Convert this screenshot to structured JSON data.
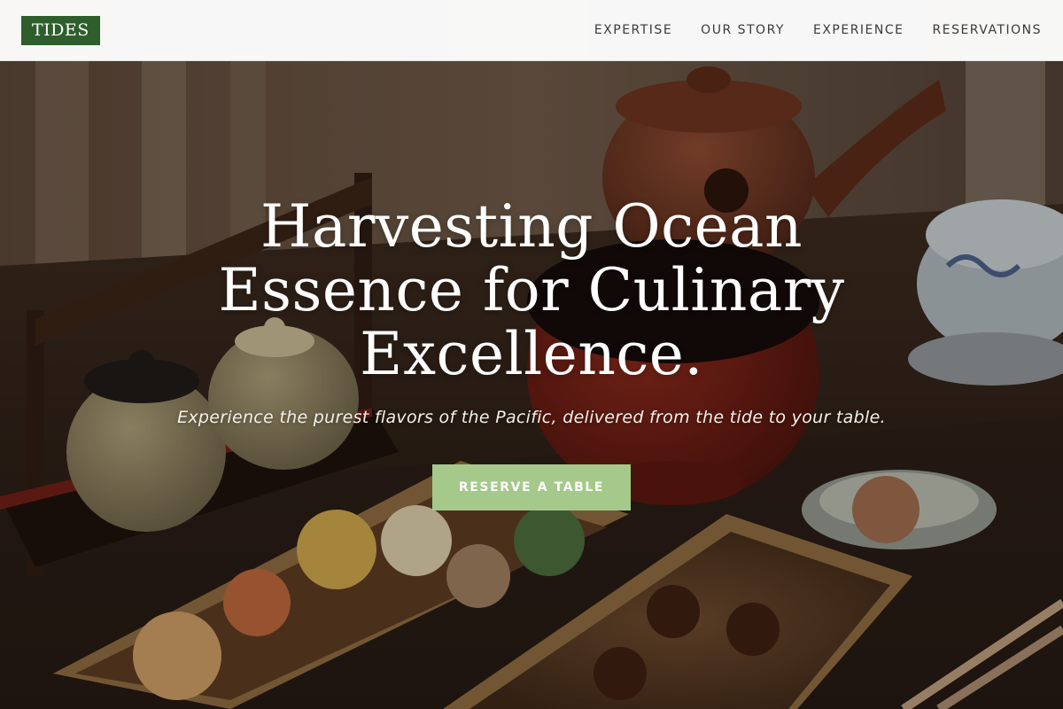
{
  "brand": {
    "logo_text": "TIDES",
    "logo_color": "#2e5e2c"
  },
  "nav": {
    "items": [
      {
        "label": "EXPERTISE"
      },
      {
        "label": "OUR STORY"
      },
      {
        "label": "EXPERIENCE"
      },
      {
        "label": "RESERVATIONS"
      }
    ]
  },
  "hero": {
    "headline": "Harvesting Ocean Essence for Culinary Excellence.",
    "subtitle": "Experience the purest flavors of the Pacific, delivered from the tide to your table.",
    "cta_label": "RESERVE A TABLE",
    "cta_color": "#a4c98b"
  }
}
